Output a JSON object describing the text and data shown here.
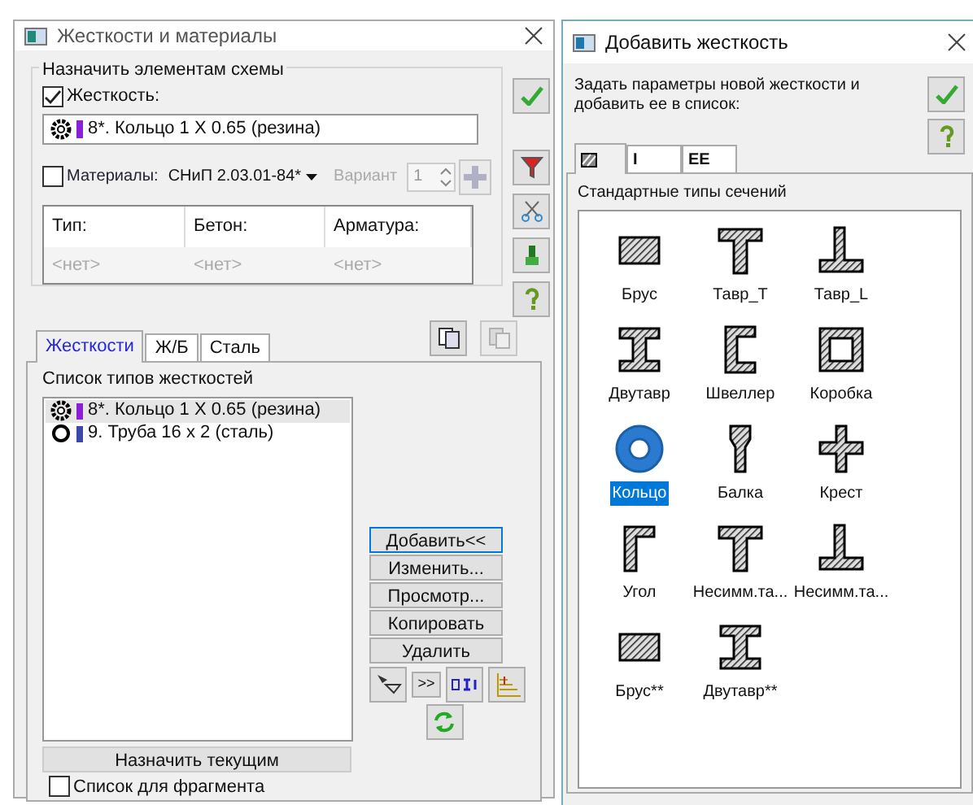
{
  "left_window": {
    "title": "Жесткости и материалы",
    "assign_group": {
      "title": "Назначить элементам схемы",
      "stiffness": {
        "label": "Жесткость:",
        "checked": true,
        "value": "8*. Кольцо 1 X 0.65 (резина)",
        "color": "#8b1fd6"
      },
      "materials": {
        "label": "Материалы:",
        "checked": false,
        "norm": "СНиП 2.03.01-84*",
        "variant_label": "Вариант",
        "variant": "1",
        "disabled": true
      },
      "table": {
        "columns": [
          "Тип:",
          "Бетон:",
          "Арматура:"
        ],
        "row": [
          "<нет>",
          "<нет>",
          "<нет>"
        ]
      }
    },
    "tabs": [
      {
        "label": "Жесткости",
        "selected": true
      },
      {
        "label": "Ж/Б",
        "selected": false
      },
      {
        "label": "Сталь",
        "selected": false
      }
    ],
    "list_title": "Список типов жесткостей",
    "items": [
      {
        "label": "8*. Кольцо 1 X 0.65 (резина)",
        "kind": "ring",
        "color": "#8b1fd6",
        "selected": true
      },
      {
        "label": "9. Труба 16 x 2 (сталь)",
        "kind": "pipe",
        "color": "#3b4aa8",
        "selected": false
      }
    ],
    "buttons": [
      "Добавить<<",
      "Изменить...",
      "Просмотр...",
      "Копировать",
      "Удалить"
    ],
    "move_button": ">>",
    "assign_button": "Назначить текущим",
    "fragment": {
      "label": "Список для фрагмента",
      "checked": false
    }
  },
  "right_window": {
    "title": "Добавить жесткость",
    "prompt": "Задать параметры новой жесткости и добавить ее в список:",
    "tabs": [
      {
        "kind": "icon",
        "selected": true
      },
      {
        "kind": "text",
        "label": "I",
        "selected": false
      },
      {
        "kind": "text",
        "label": "EE",
        "selected": false
      }
    ],
    "group_title": "Стандартные типы сечений",
    "sections": [
      {
        "label": "Брус",
        "kind": "rect",
        "selected": false
      },
      {
        "label": "Тавр_Т",
        "kind": "tee",
        "selected": false
      },
      {
        "label": "Тавр_L",
        "kind": "teel",
        "selected": false
      },
      {
        "label": "Двутавр",
        "kind": "ibeam",
        "selected": false
      },
      {
        "label": "Швеллер",
        "kind": "channel",
        "selected": false
      },
      {
        "label": "Коробка",
        "kind": "box",
        "selected": false
      },
      {
        "label": "Кольцо",
        "kind": "ring",
        "selected": true
      },
      {
        "label": "Балка",
        "kind": "beam",
        "selected": false
      },
      {
        "label": "Крест",
        "kind": "cross",
        "selected": false
      },
      {
        "label": "Угол",
        "kind": "angle",
        "selected": false
      },
      {
        "label": "Несимм.та...",
        "kind": "tee",
        "selected": false
      },
      {
        "label": "Несимм.та...",
        "kind": "teel",
        "selected": false
      },
      {
        "label": "Брус**",
        "kind": "rect",
        "selected": false
      },
      {
        "label": "Двутавр**",
        "kind": "ibeam",
        "selected": false
      }
    ]
  }
}
